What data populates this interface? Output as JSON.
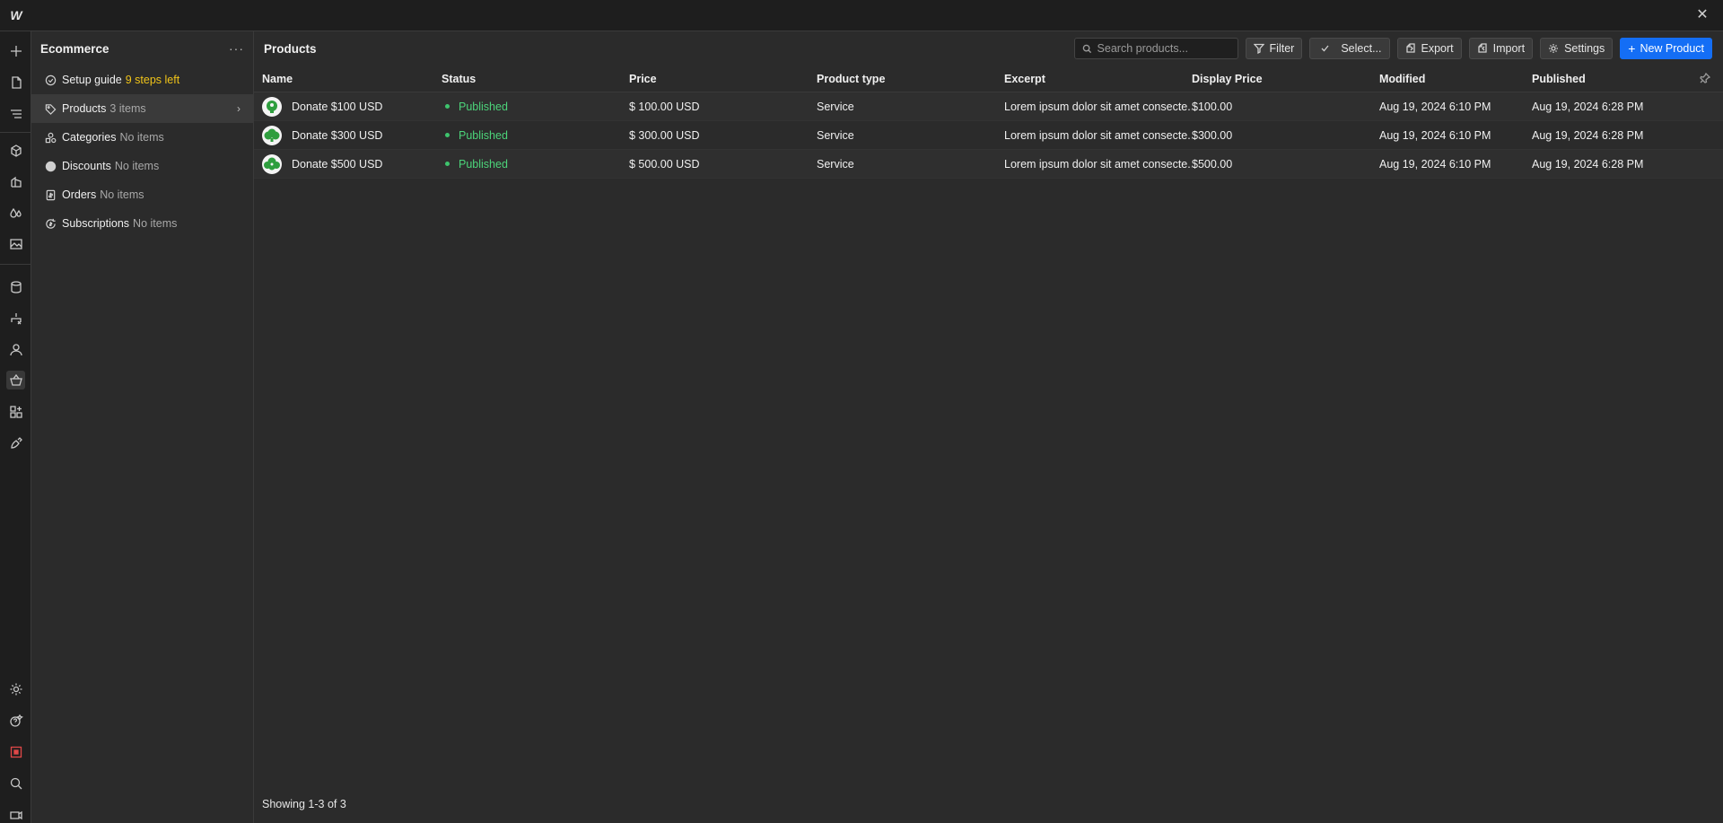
{
  "app": {
    "logo_text": "W",
    "close_label": "✕"
  },
  "sidebar": {
    "title": "Ecommerce",
    "more_label": "···",
    "items": [
      {
        "label": "Setup guide",
        "count": "9 steps left",
        "icon": "check-circle-icon"
      },
      {
        "label": "Products",
        "count": "3 items",
        "icon": "tag-icon"
      },
      {
        "label": "Categories",
        "count": "No items",
        "icon": "categories-icon"
      },
      {
        "label": "Discounts",
        "count": "No items",
        "icon": "discount-icon"
      },
      {
        "label": "Orders",
        "count": "No items",
        "icon": "orders-icon"
      },
      {
        "label": "Subscriptions",
        "count": "No items",
        "icon": "subscriptions-icon"
      }
    ]
  },
  "main": {
    "title": "Products",
    "search": {
      "placeholder": "Search products..."
    },
    "toolbar": {
      "filter": "Filter",
      "select": "Select...",
      "export": "Export",
      "import": "Import",
      "settings": "Settings",
      "new_product": "New Product"
    },
    "columns": [
      "Name",
      "Status",
      "Price",
      "Product type",
      "Excerpt",
      "Display Price",
      "Modified",
      "Published"
    ],
    "rows": [
      {
        "name": "Donate $100 USD",
        "status": "Published",
        "price": "$ 100.00 USD",
        "type": "Service",
        "excerpt": "Lorem ipsum dolor sit amet consecte...",
        "display_price": "$100.00",
        "modified": "Aug 19, 2024 6:10 PM",
        "published": "Aug 19, 2024 6:28 PM"
      },
      {
        "name": "Donate $300 USD",
        "status": "Published",
        "price": "$ 300.00 USD",
        "type": "Service",
        "excerpt": "Lorem ipsum dolor sit amet consecte...",
        "display_price": "$300.00",
        "modified": "Aug 19, 2024 6:10 PM",
        "published": "Aug 19, 2024 6:28 PM"
      },
      {
        "name": "Donate $500 USD",
        "status": "Published",
        "price": "$ 500.00 USD",
        "type": "Service",
        "excerpt": "Lorem ipsum dolor sit amet consecte...",
        "display_price": "$500.00",
        "modified": "Aug 19, 2024 6:10 PM",
        "published": "Aug 19, 2024 6:28 PM"
      }
    ],
    "footer": "Showing 1-3 of 3"
  },
  "colors": {
    "accent": "#146ef5",
    "status_published": "#4cd47a",
    "warning": "#f0c419",
    "background": "#2b2b2b"
  }
}
